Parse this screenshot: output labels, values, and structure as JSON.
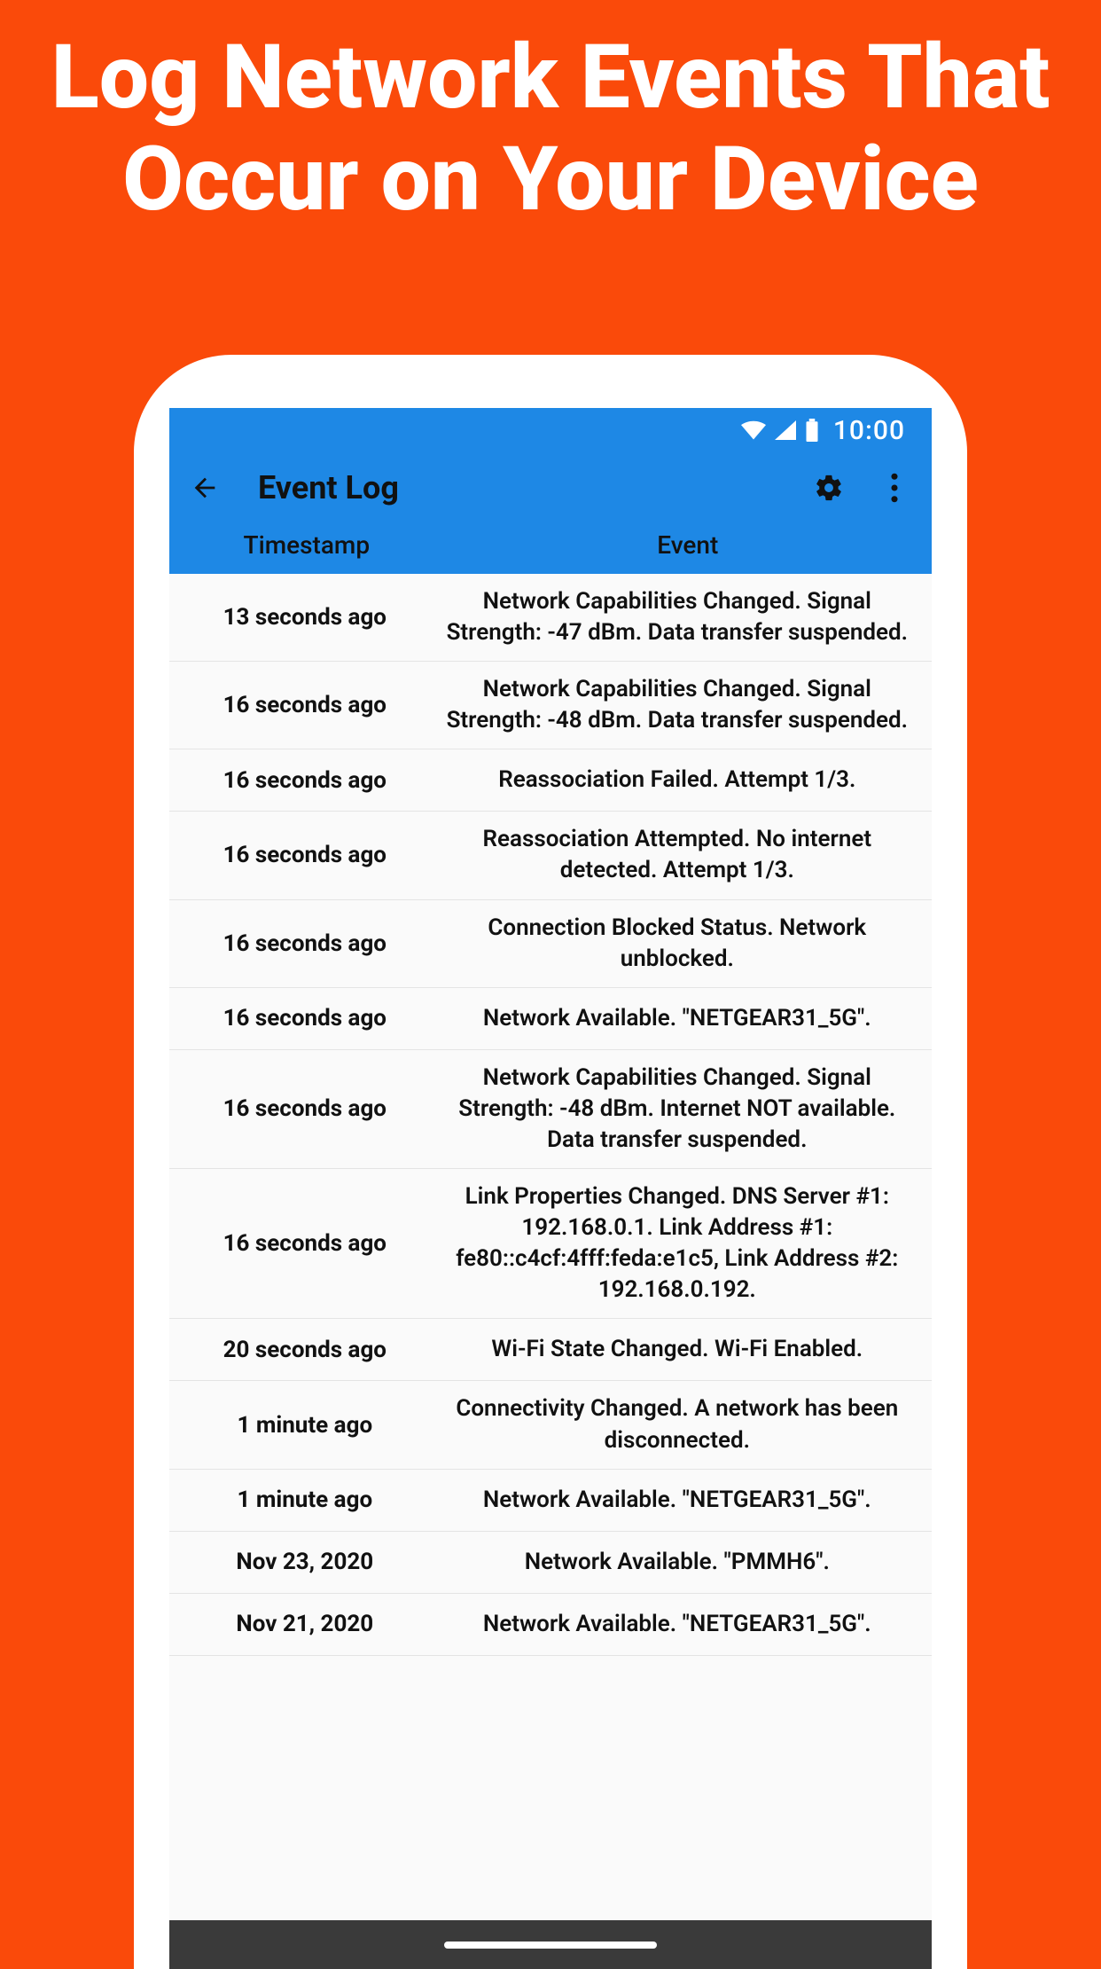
{
  "promo": {
    "title": "Log Network Events That Occur on Your Device"
  },
  "status": {
    "time": "10:00"
  },
  "toolbar": {
    "title": "Event Log"
  },
  "columns": {
    "timestamp": "Timestamp",
    "event": "Event"
  },
  "events": [
    {
      "ts": "13 seconds ago",
      "ev": "Network Capabilities Changed.  Signal Strength: -47 dBm. Data transfer suspended."
    },
    {
      "ts": "16 seconds ago",
      "ev": "Network Capabilities Changed.  Signal Strength: -48 dBm. Data transfer suspended."
    },
    {
      "ts": "16 seconds ago",
      "ev": "Reassociation Failed. Attempt 1/3."
    },
    {
      "ts": "16 seconds ago",
      "ev": "Reassociation Attempted. No internet detected. Attempt 1/3."
    },
    {
      "ts": "16 seconds ago",
      "ev": "Connection Blocked Status. Network unblocked."
    },
    {
      "ts": "16 seconds ago",
      "ev": "Network Available.  \"NETGEAR31_5G\"."
    },
    {
      "ts": "16 seconds ago",
      "ev": "Network Capabilities Changed.  Signal Strength: -48 dBm. Internet NOT available. Data transfer suspended."
    },
    {
      "ts": "16 seconds ago",
      "ev": "Link Properties Changed.  DNS Server #1: 192.168.0.1. Link Address #1: fe80::c4cf:4fff:feda:e1c5, Link Address #2: 192.168.0.192."
    },
    {
      "ts": "20 seconds ago",
      "ev": "Wi-Fi State Changed. Wi-Fi Enabled."
    },
    {
      "ts": "1 minute ago",
      "ev": "Connectivity Changed. A network has been disconnected."
    },
    {
      "ts": "1 minute ago",
      "ev": "Network Available.  \"NETGEAR31_5G\"."
    },
    {
      "ts": "Nov 23, 2020",
      "ev": "Network Available.  \"PMMH6\"."
    },
    {
      "ts": "Nov 21, 2020",
      "ev": "Network Available.  \"NETGEAR31_5G\"."
    }
  ]
}
